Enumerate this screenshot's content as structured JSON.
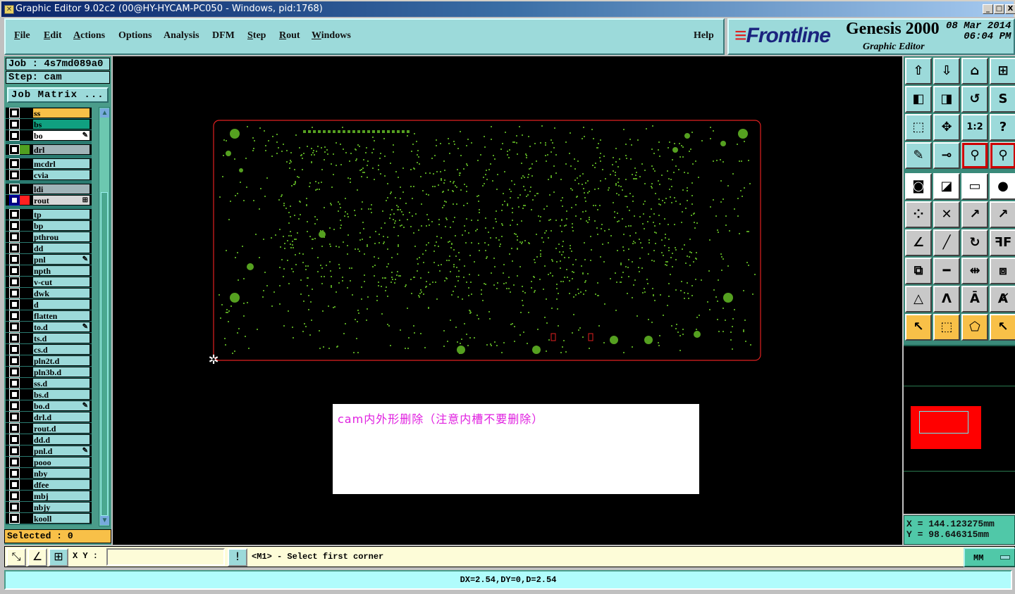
{
  "window": {
    "title": "Graphic Editor 9.02c2 (00@HY-HYCAM-PC050 - Windows, pid:1768)",
    "minimize": "_",
    "maximize": "□",
    "close": "X"
  },
  "menu": [
    {
      "label": "File",
      "u": "F",
      "rest": "ile"
    },
    {
      "label": "Edit",
      "u": "E",
      "rest": "dit"
    },
    {
      "label": "Actions",
      "u": "A",
      "rest": "ctions"
    },
    {
      "label": "Options",
      "u": "",
      "rest": "Options"
    },
    {
      "label": "Analysis",
      "u": "",
      "rest": "Analysis"
    },
    {
      "label": "DFM",
      "u": "",
      "rest": "DFM"
    },
    {
      "label": "Step",
      "u": "S",
      "rest": "tep"
    },
    {
      "label": "Rout",
      "u": "R",
      "rest": "out"
    },
    {
      "label": "Windows",
      "u": "W",
      "rest": "indows"
    },
    {
      "label": "Help",
      "u": "",
      "rest": "Help"
    }
  ],
  "logo": {
    "brand": "Frontline",
    "product": "Genesis 2000",
    "subtitle": "Graphic Editor",
    "date": "08 Mar 2014",
    "time": "06:04 PM"
  },
  "job": {
    "job_label": "Job  :  4s7md089a0",
    "step_label": "Step:  cam",
    "matrix_button": "Job Matrix ..."
  },
  "layers": [
    {
      "name": "ss",
      "bg": "#f8c048"
    },
    {
      "name": "bs",
      "bg": "#10a080"
    },
    {
      "name": "bo",
      "bg": "#ffffff",
      "mark": "✎"
    },
    {
      "name": "drl",
      "bg": "#a0b4b8",
      "swatch": "#50a020",
      "gap": true
    },
    {
      "name": "mcdrl",
      "bg": "#9cdada",
      "gap": true
    },
    {
      "name": "cvia",
      "bg": "#9cdada"
    },
    {
      "name": "ldi",
      "bg": "#a0b4b8",
      "gap": true
    },
    {
      "name": "rout",
      "bg": "#d8d8d8",
      "swatch": "#ff2020",
      "active": true,
      "mark": "⊞"
    },
    {
      "name": "tp",
      "bg": "#9cdada",
      "gap": true
    },
    {
      "name": "bp",
      "bg": "#9cdada"
    },
    {
      "name": "pthrou",
      "bg": "#9cdada"
    },
    {
      "name": "dd",
      "bg": "#9cdada"
    },
    {
      "name": "pnl",
      "bg": "#9cdada",
      "mark": "✎"
    },
    {
      "name": "npth",
      "bg": "#9cdada"
    },
    {
      "name": "v-cut",
      "bg": "#9cdada"
    },
    {
      "name": "dwk",
      "bg": "#9cdada"
    },
    {
      "name": "d",
      "bg": "#9cdada"
    },
    {
      "name": "flatten",
      "bg": "#9cdada"
    },
    {
      "name": "to.d",
      "bg": "#9cdada",
      "mark": "✎"
    },
    {
      "name": "ts.d",
      "bg": "#9cdada"
    },
    {
      "name": "cs.d",
      "bg": "#9cdada"
    },
    {
      "name": "pln2t.d",
      "bg": "#9cdada"
    },
    {
      "name": "pln3b.d",
      "bg": "#9cdada"
    },
    {
      "name": "ss.d",
      "bg": "#9cdada"
    },
    {
      "name": "bs.d",
      "bg": "#9cdada"
    },
    {
      "name": "bo.d",
      "bg": "#9cdada",
      "mark": "✎"
    },
    {
      "name": "drl.d",
      "bg": "#9cdada"
    },
    {
      "name": "rout.d",
      "bg": "#9cdada"
    },
    {
      "name": "dd.d",
      "bg": "#9cdada"
    },
    {
      "name": "pnl.d",
      "bg": "#9cdada",
      "mark": "✎"
    },
    {
      "name": "pooo",
      "bg": "#9cdada"
    },
    {
      "name": "nby",
      "bg": "#9cdada"
    },
    {
      "name": "dfee",
      "bg": "#9cdada"
    },
    {
      "name": "mbj",
      "bg": "#9cdada"
    },
    {
      "name": "nbjy",
      "bg": "#9cdada"
    },
    {
      "name": "kooll",
      "bg": "#9cdada"
    }
  ],
  "selected": "Selected : 0",
  "canvas": {
    "note": "cam内外形删除（注意内槽不要删除）",
    "profile_color": "#e02020",
    "pad_color": "#55a020"
  },
  "toolbar": [
    {
      "icon": "move-up-icon",
      "glyph": "⇧",
      "s": "c"
    },
    {
      "icon": "move-down-icon",
      "glyph": "⇩",
      "s": "c"
    },
    {
      "icon": "home-icon",
      "glyph": "⌂",
      "s": "c"
    },
    {
      "icon": "grid-xy-icon",
      "glyph": "⊞",
      "s": "c"
    },
    {
      "icon": "pan-left-icon",
      "glyph": "◧",
      "s": "c"
    },
    {
      "icon": "pan-right-icon",
      "glyph": "◨",
      "s": "c"
    },
    {
      "icon": "undo-zoom-icon",
      "glyph": "↺",
      "s": "c"
    },
    {
      "icon": "snake-icon",
      "glyph": "S",
      "s": "c"
    },
    {
      "icon": "zoom-fit-icon",
      "glyph": "⬚",
      "s": "c"
    },
    {
      "icon": "zoom-center-icon",
      "glyph": "✥",
      "s": "c"
    },
    {
      "icon": "scale-icon",
      "glyph": "1:2",
      "s": "c"
    },
    {
      "icon": "help-icon",
      "glyph": "?",
      "s": "c"
    },
    {
      "icon": "tools-icon",
      "glyph": "✎",
      "s": "c"
    },
    {
      "icon": "snap-icon",
      "glyph": "⊸",
      "s": "c"
    },
    {
      "icon": "net-highlight-icon",
      "glyph": "⚲",
      "s": "c",
      "r": true
    },
    {
      "icon": "net-highlight-2-icon",
      "glyph": "⚲",
      "s": "c",
      "r": true
    },
    {
      "icon": "feature-select-icon",
      "glyph": "◙",
      "s": "w"
    },
    {
      "icon": "resize-icon",
      "glyph": "◪",
      "s": "w"
    },
    {
      "icon": "measure-ruler-icon",
      "glyph": "▭",
      "s": "w"
    },
    {
      "icon": "pad-icon",
      "glyph": "●",
      "s": "w"
    },
    {
      "icon": "connect-icon",
      "glyph": "⁘",
      "s": "g"
    },
    {
      "icon": "delete-x-icon",
      "glyph": "✕",
      "s": "g"
    },
    {
      "icon": "move-pad-icon",
      "glyph": "↗",
      "s": "g"
    },
    {
      "icon": "copy-pad-icon",
      "glyph": "↗",
      "s": "g"
    },
    {
      "icon": "angle-icon",
      "glyph": "∠",
      "s": "g"
    },
    {
      "icon": "line-icon",
      "glyph": "╱",
      "s": "g"
    },
    {
      "icon": "rotate-icon",
      "glyph": "↻",
      "s": "g"
    },
    {
      "icon": "mirror-icon",
      "glyph": "ꟻF",
      "s": "g"
    },
    {
      "icon": "move-square-icon",
      "glyph": "⧉",
      "s": "g"
    },
    {
      "icon": "horizontal-line-icon",
      "glyph": "━",
      "s": "g"
    },
    {
      "icon": "dimension-icon",
      "glyph": "⇹",
      "s": "g"
    },
    {
      "icon": "overlap-icon",
      "glyph": "⧈",
      "s": "g"
    },
    {
      "icon": "shape-1-icon",
      "glyph": "△",
      "s": "g"
    },
    {
      "icon": "shape-2-icon",
      "glyph": "Λ",
      "s": "g"
    },
    {
      "icon": "shape-3-icon",
      "glyph": "Ā",
      "s": "g"
    },
    {
      "icon": "shape-4-icon",
      "glyph": "Ⱥ",
      "s": "g"
    },
    {
      "icon": "pointer-icon",
      "glyph": "↖",
      "s": "y"
    },
    {
      "icon": "pointer-box-icon",
      "glyph": "⬚",
      "s": "y"
    },
    {
      "icon": "pointer-poly-icon",
      "glyph": "⬠",
      "s": "y"
    },
    {
      "icon": "pointer-net-icon",
      "glyph": "↖",
      "s": "y"
    }
  ],
  "coords": {
    "x": "X  =  144.123275mm",
    "y": "Y  =  98.646315mm"
  },
  "bottom": {
    "xy_label": "X Y :",
    "xy_value": "",
    "prompt": "<M1> - Select first corner",
    "units": "MM"
  },
  "status": "DX=2.54,DY=0,D=2.54"
}
